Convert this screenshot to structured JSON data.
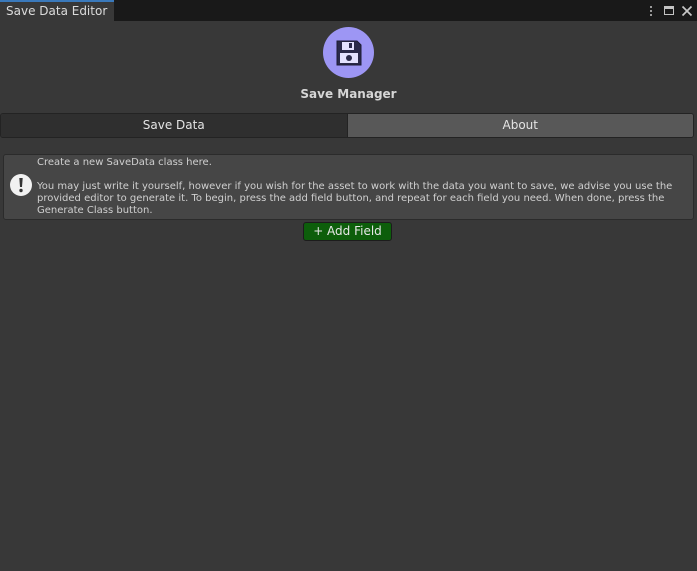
{
  "window": {
    "tab_title": "Save Data Editor",
    "controls": [
      "kebab-menu-icon",
      "maximize-icon",
      "close-icon"
    ]
  },
  "header": {
    "logo_icon": "floppy-disk-icon",
    "logo_color": "#9d96f4",
    "title": "Save Manager"
  },
  "toolbar": {
    "tabs": [
      {
        "label": "Save Data",
        "selected": true
      },
      {
        "label": "About",
        "selected": false
      }
    ]
  },
  "helpbox": {
    "icon": "warning-icon",
    "line1": "Create a new SaveData class here.",
    "line2": "You may just write it yourself, however if you wish for the asset to work with the data you want to save, we advise you use the provided editor to generate it. To begin, press the add field button, and repeat for each field you need. When done, press the Generate Class button."
  },
  "actions": {
    "add_field_label": "+ Add Field",
    "add_field_color": "#0d5e0b"
  }
}
